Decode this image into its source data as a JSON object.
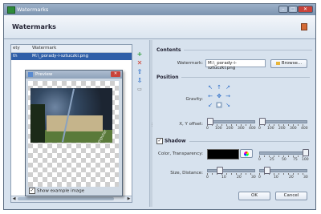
{
  "window": {
    "title": "Watermarks",
    "header_title": "Watermarks"
  },
  "list": {
    "columns": [
      "ety",
      "Watermark"
    ],
    "rows": [
      {
        "col1": "th",
        "col2": "M:\\_porady-i-sztuczki.png"
      }
    ]
  },
  "side_buttons": [
    "add",
    "remove",
    "move-up",
    "move-down",
    "document"
  ],
  "preview": {
    "title": "Preview",
    "checkbox_label": "Show example image",
    "checkbox_checked": true,
    "watermark_text": "Komputer"
  },
  "contents": {
    "section": "Contents",
    "watermark_label": "Watermark:",
    "watermark_value": "M:\\_porady-i-sztuczki.png",
    "browse_label": "Browse..."
  },
  "position": {
    "section": "Position",
    "gravity_label": "Gravity:",
    "offset_label": "X, Y offset:",
    "x_ticks": [
      "0",
      "100",
      "200",
      "300",
      "400"
    ],
    "y_ticks": [
      "0",
      "100",
      "200",
      "300",
      "400"
    ]
  },
  "shadow": {
    "checkbox_label": "Shadow",
    "checked": true,
    "color_label": "Color, Transparency:",
    "color": "#000000",
    "transparency_ticks": [
      "0",
      "25",
      "50",
      "75",
      "100"
    ],
    "size_label": "Size, Distance:",
    "size_ticks": [
      "0",
      "10",
      "20",
      "30"
    ],
    "distance_ticks": [
      "0",
      "10",
      "20",
      "30"
    ]
  },
  "buttons": {
    "ok": "OK",
    "cancel": "Cancel"
  },
  "colors": {
    "title_bar": "#8aa0bc",
    "selection": "#2f5fa8",
    "add": "#2e9b3a",
    "remove": "#d03a2a",
    "arrow": "#2f6fc8"
  }
}
